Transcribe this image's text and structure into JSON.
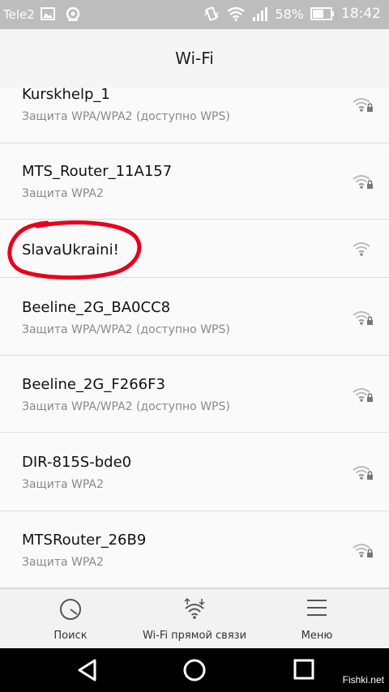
{
  "status_bar": {
    "carrier": "Tele2",
    "battery_percent": "58%",
    "time": "18:42",
    "icons": [
      "image-icon",
      "location-icon",
      "vibrate-icon",
      "wifi-icon",
      "signal-icon",
      "battery-icon"
    ]
  },
  "header": {
    "title": "Wi-Fi"
  },
  "networks": [
    {
      "ssid": "Kurskhelp_1",
      "security": "Защита WPA/WPA2 (доступно WPS)",
      "locked": true
    },
    {
      "ssid": "MTS_Router_11A157",
      "security": "Защита WPA2",
      "locked": true
    },
    {
      "ssid": "SlavaUkraini!",
      "security": "",
      "locked": false,
      "highlight_color": "#e8001c"
    },
    {
      "ssid": "Beeline_2G_BA0CC8",
      "security": "Защита WPA/WPA2 (доступно WPS)",
      "locked": true
    },
    {
      "ssid": "Beeline_2G_F266F3",
      "security": "Защита WPA/WPA2 (доступно WPS)",
      "locked": true
    },
    {
      "ssid": "DIR-815S-bde0",
      "security": "Защита WPA2",
      "locked": true
    },
    {
      "ssid": "MTSRouter_26B9",
      "security": "Защита WPA2",
      "locked": true
    }
  ],
  "bottom_bar": {
    "search_label": "Поиск",
    "wifi_direct_label": "Wi-Fi прямой связи",
    "menu_label": "Меню"
  },
  "watermark": "Fishki.net",
  "colors": {
    "accent_highlight": "#e8001c",
    "status_bar": "#bdbdbd",
    "navbar": "#000000"
  }
}
